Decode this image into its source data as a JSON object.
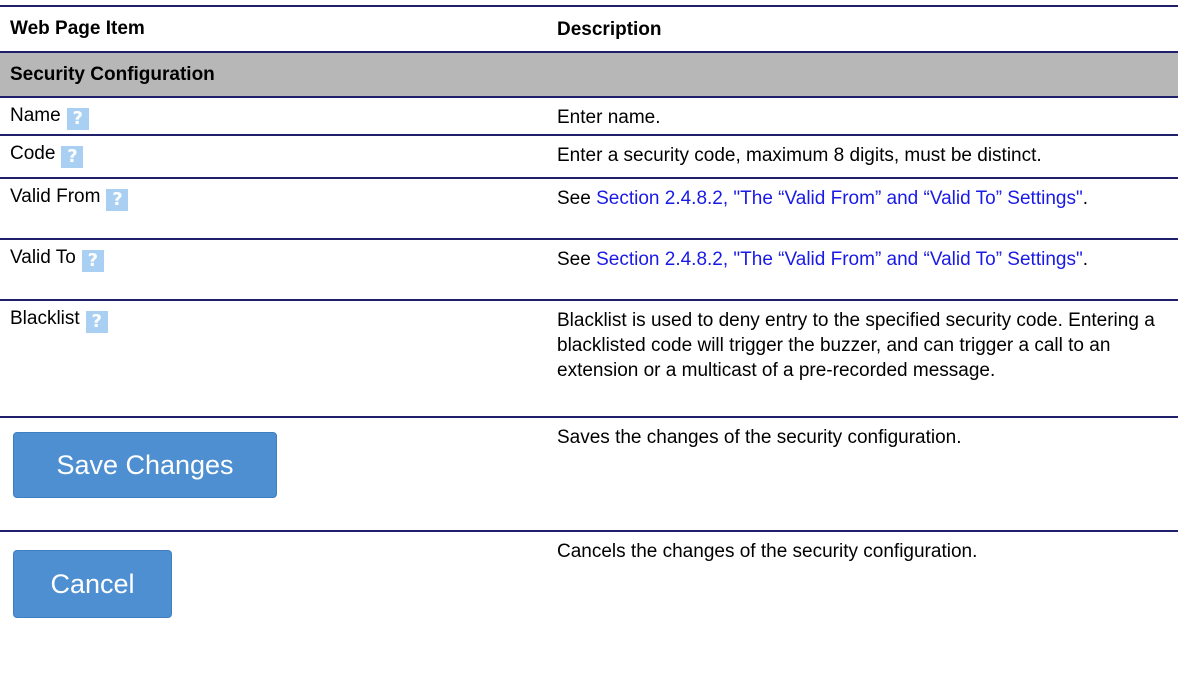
{
  "table": {
    "col1_header": "Web Page Item",
    "col2_header": "Description",
    "section_title": "Security Configuration",
    "rows": [
      {
        "item": "Name",
        "desc": "Enter name."
      },
      {
        "item": "Code",
        "desc": "Enter a security code, maximum 8 digits, must be distinct."
      },
      {
        "item": "Valid From",
        "desc_prefix": "See ",
        "desc_link": "Section 2.4.8.2, \"The “Valid From” and “Valid To” Settings\"",
        "desc_suffix": "."
      },
      {
        "item": "Valid To",
        "desc_prefix": "See ",
        "desc_link": "Section 2.4.8.2, \"The “Valid From” and “Valid To” Settings\"",
        "desc_suffix": "."
      },
      {
        "item": "Blacklist",
        "desc": "Blacklist is used to deny entry to the specified security code. Entering a blacklisted code will trigger the buzzer, and can trigger a call to an extension or a multicast of a pre-recorded message."
      }
    ],
    "save_button": {
      "label": "Save Changes",
      "desc": "Saves the changes of the security configuration."
    },
    "cancel_button": {
      "label": "Cancel",
      "desc": "Cancels the changes of the security configuration."
    }
  },
  "icons": {
    "help": "help-question-icon",
    "help_glyph": "?"
  },
  "colors": {
    "rule": "#1f1f6b",
    "section_bg": "#b7b7b7",
    "button_bg": "#4d8fd0",
    "help_icon_bg": "#a9cff3",
    "link": "#1a1ae6"
  }
}
